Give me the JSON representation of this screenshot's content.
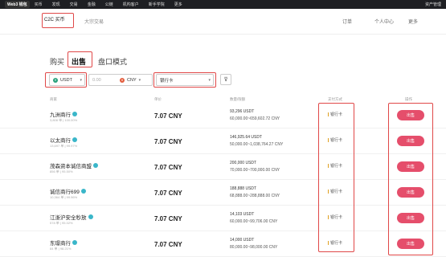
{
  "topnav": {
    "logo": "Web3 钱包",
    "items": [
      "买币",
      "发现",
      "交易",
      "金融",
      "公链",
      "机构客户",
      "新手学院",
      "更多"
    ],
    "right": [
      "资产管理"
    ]
  },
  "subnav": {
    "c2c": "C2C 买币",
    "bulk": "大宗交易",
    "orders": "订单",
    "personal": "个人中心",
    "more": "更多"
  },
  "tabs": [
    "购买",
    "出售",
    "盘口模式"
  ],
  "filters": {
    "coin": "USDT",
    "amount_placeholder": "0.00",
    "currency": "CNY",
    "payment": "银行卡"
  },
  "table": {
    "headers": [
      "商家",
      "单价",
      "数量/限额",
      "支付方式",
      "操作"
    ],
    "rows": [
      {
        "name": "九洲商行",
        "stats": "3,808 单 | 100.00%",
        "price": "7.07 CNY",
        "available": "93,296 USDT",
        "limit": "60,000.00~659,602.72 CNY",
        "payment": "银行卡",
        "action": "出售"
      },
      {
        "name": "以太商行",
        "stats": "13,697 单 | 99.97%",
        "price": "7.07 CNY",
        "available": "146,925.64 USDT",
        "limit": "50,000.00~1,038,764.27 CNY",
        "payment": "银行卡",
        "action": "出售"
      },
      {
        "name": "茂森资本诚信商盟",
        "stats": "856 单 | 95.50%",
        "price": "7.07 CNY",
        "available": "200,000 USDT",
        "limit": "70,000.00~700,000.00 CNY",
        "payment": "银行卡",
        "action": "出售"
      },
      {
        "name": "诚信商行699",
        "stats": "10,364 单 | 99.96%",
        "price": "7.07 CNY",
        "available": "188,888 USDT",
        "limit": "68,888.00~288,888.00 CNY",
        "payment": "银行卡",
        "action": "出售"
      },
      {
        "name": "江浙沪安全秒放",
        "stats": "578 单 | 95.02%",
        "price": "7.07 CNY",
        "available": "14,103 USDT",
        "limit": "60,000.00~99,706.00 CNY",
        "payment": "银行卡",
        "action": "出售"
      },
      {
        "name": "东璟商行",
        "stats": "84 单 | 98.21%",
        "price": "7.07 CNY",
        "available": "14,000 USDT",
        "limit": "80,000.00~98,000.00 CNY",
        "payment": "银行卡",
        "action": "出售"
      }
    ]
  },
  "colors": {
    "accent_red": "#e54e6b",
    "highlight_box": "#e04848",
    "topbar": "#1e1f23"
  }
}
